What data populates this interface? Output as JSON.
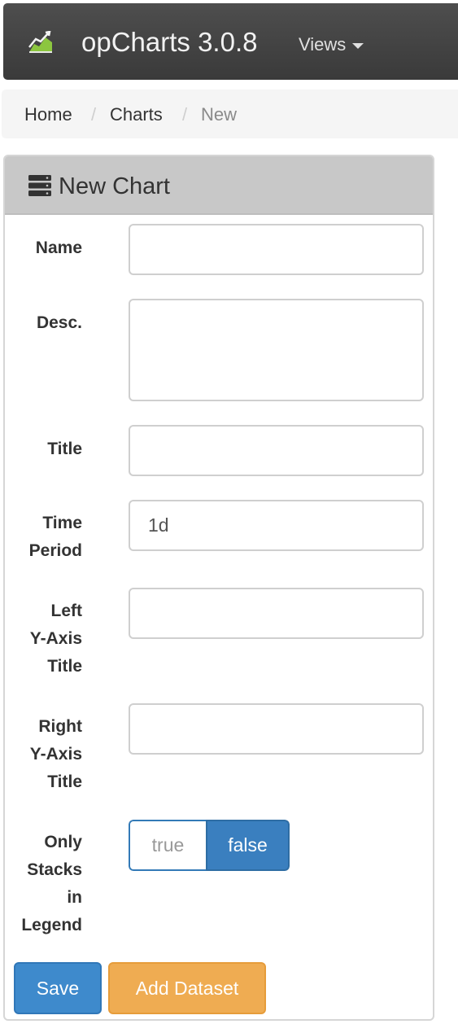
{
  "navbar": {
    "brand": "opCharts 3.0.8",
    "brand_icon": "area-chart-icon",
    "views_label": "Views"
  },
  "breadcrumb": {
    "items": [
      "Home",
      "Charts",
      "New"
    ]
  },
  "panel": {
    "title": "New Chart",
    "icon": "server-icon"
  },
  "form": {
    "name": {
      "label": "Name",
      "value": ""
    },
    "desc": {
      "label": "Desc.",
      "value": ""
    },
    "title": {
      "label": "Title",
      "value": ""
    },
    "time_period": {
      "label_lines": [
        "Time",
        "Period"
      ],
      "value": "1d"
    },
    "left_y_axis_title": {
      "label_lines": [
        "Left",
        "Y-Axis",
        "Title"
      ],
      "value": ""
    },
    "right_y_axis_title": {
      "label_lines": [
        "Right",
        "Y-Axis",
        "Title"
      ],
      "value": ""
    },
    "only_stacks_in_legend": {
      "label_lines": [
        "Only",
        "Stacks",
        "in",
        "Legend"
      ],
      "options": [
        "true",
        "false"
      ],
      "selected": "false"
    }
  },
  "buttons": {
    "save": "Save",
    "add_dataset": "Add Dataset"
  },
  "colors": {
    "primary": "#3e8acc",
    "warning": "#efac52",
    "navbar": "#444444"
  }
}
